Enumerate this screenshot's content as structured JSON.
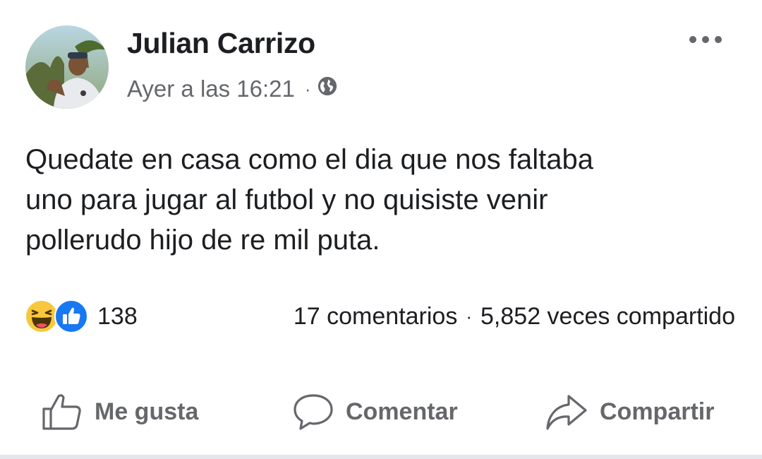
{
  "post": {
    "author": "Julian Carrizo",
    "timestamp": "Ayer a las 16:21",
    "separator": "·",
    "privacy_icon": "globe-icon",
    "more_icon": "more-options-icon",
    "text_lines": [
      "Quedate en casa como el dia que nos faltaba",
      "uno para jugar al futbol y no quisiste venir",
      "pollerudo hijo de re mil puta."
    ]
  },
  "stats": {
    "reaction_icons": [
      "haha-reaction-icon",
      "like-reaction-icon"
    ],
    "reaction_count": "138",
    "comments": "17 comentarios",
    "separator": "·",
    "shares": "5,852 veces compartido"
  },
  "actions": {
    "like_label": "Me gusta",
    "comment_label": "Comentar",
    "share_label": "Compartir"
  },
  "colors": {
    "text_primary": "#1c1e21",
    "text_secondary": "#65676b",
    "like_blue": "#1877f2",
    "haha_yellow": "#f7c83c"
  }
}
